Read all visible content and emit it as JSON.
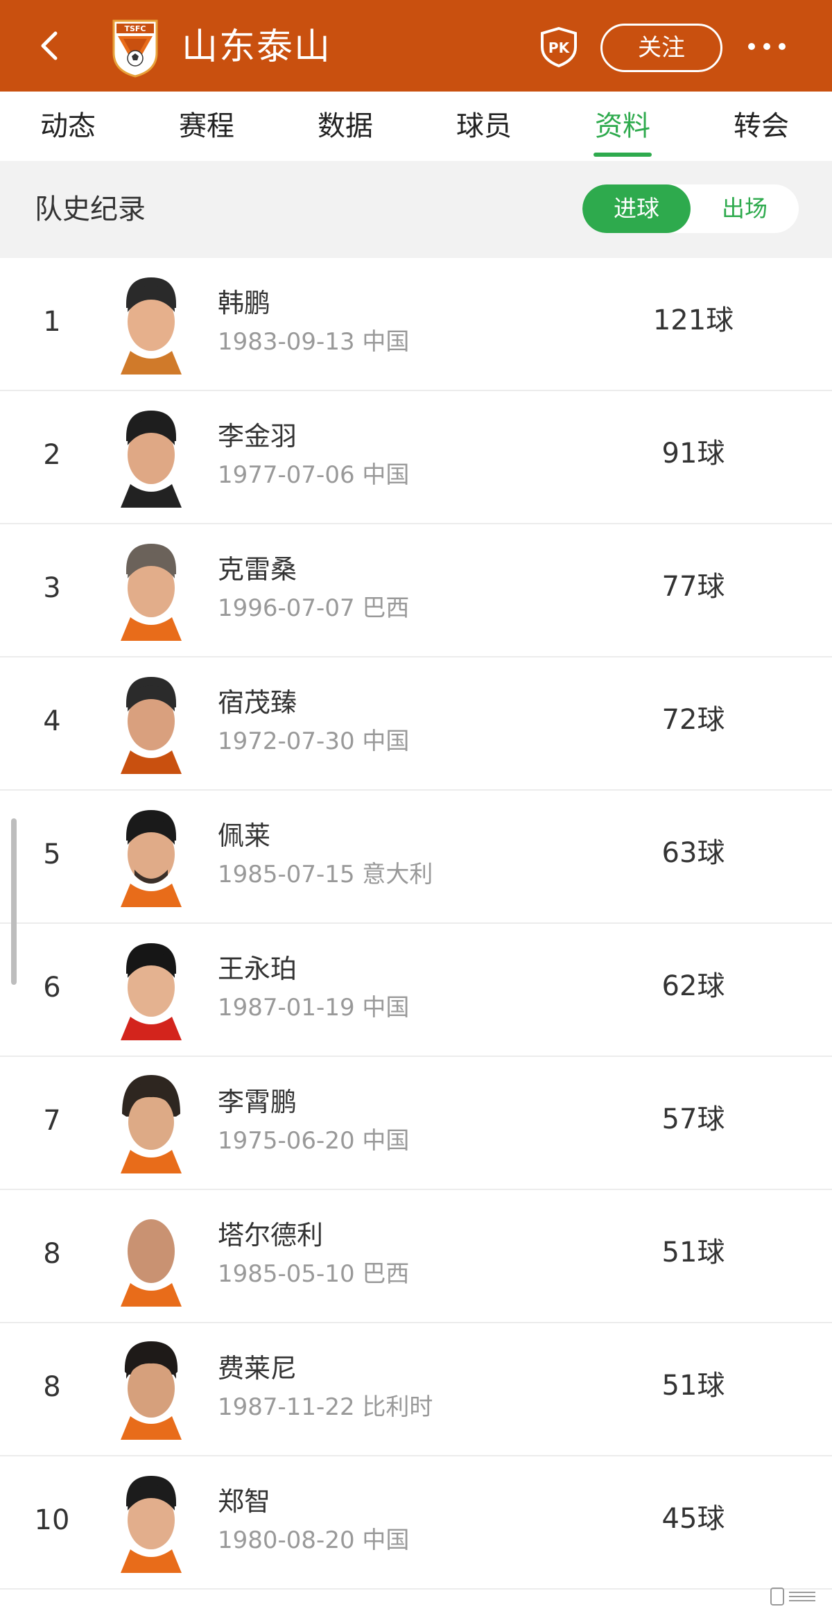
{
  "header": {
    "back_icon": "chevron-left-icon",
    "logo_text": "TSFC",
    "team_name": "山东泰山",
    "pk_label": "PK",
    "follow_label": "关注",
    "more_icon": "more-dots-icon"
  },
  "tabs": [
    {
      "label": "动态",
      "active": false
    },
    {
      "label": "赛程",
      "active": false
    },
    {
      "label": "数据",
      "active": false
    },
    {
      "label": "球员",
      "active": false
    },
    {
      "label": "资料",
      "active": true
    },
    {
      "label": "转会",
      "active": false
    }
  ],
  "section": {
    "title": "队史纪录",
    "toggle": {
      "active": "进球",
      "inactive": "出场"
    }
  },
  "players": [
    {
      "rank": "1",
      "name": "韩鹏",
      "meta": "1983-09-13 中国",
      "goals": "121球"
    },
    {
      "rank": "2",
      "name": "李金羽",
      "meta": "1977-07-06 中国",
      "goals": "91球"
    },
    {
      "rank": "3",
      "name": "克雷桑",
      "meta": "1996-07-07 巴西",
      "goals": "77球"
    },
    {
      "rank": "4",
      "name": "宿茂臻",
      "meta": "1972-07-30 中国",
      "goals": "72球"
    },
    {
      "rank": "5",
      "name": "佩莱",
      "meta": "1985-07-15 意大利",
      "goals": "63球"
    },
    {
      "rank": "6",
      "name": "王永珀",
      "meta": "1987-01-19 中国",
      "goals": "62球"
    },
    {
      "rank": "7",
      "name": "李霄鹏",
      "meta": "1975-06-20 中国",
      "goals": "57球"
    },
    {
      "rank": "8",
      "name": "塔尔德利",
      "meta": "1985-05-10 巴西",
      "goals": "51球"
    },
    {
      "rank": "8",
      "name": "费莱尼",
      "meta": "1987-11-22 比利时",
      "goals": "51球"
    },
    {
      "rank": "10",
      "name": "郑智",
      "meta": "1980-08-20 中国",
      "goals": "45球"
    }
  ],
  "colors": {
    "header_bg": "#c9500f",
    "accent_green": "#2eaa4d"
  }
}
